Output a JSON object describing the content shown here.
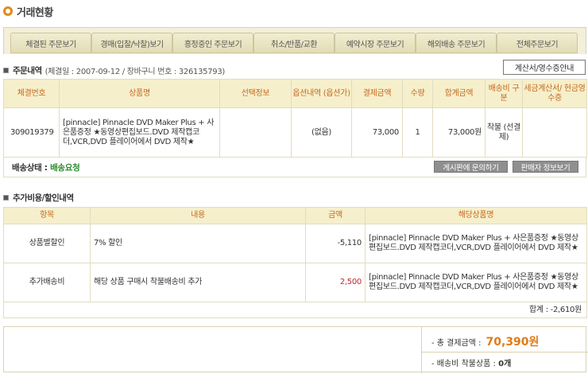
{
  "page": {
    "title": "거래현황"
  },
  "tabs": [
    "체결된 주문보기",
    "경매(입찰/낙찰)보기",
    "흥정중인 주문보기",
    "취소/반품/교환",
    "예약시장 주문보기",
    "해외배송 주문보기",
    "전체주문보기"
  ],
  "order": {
    "section_title": "주문내역",
    "section_sub": "(체결일 : 2007-09-12 / 장바구니 번호 : 326135793)",
    "receipt_button": "계산서/영수증안내",
    "headers": [
      "체결번호",
      "상품명",
      "선택정보",
      "옵션내역 (옵션가)",
      "결제금액",
      "수량",
      "합계금액",
      "배송비 구분",
      "세금계산서/ 현금영수증"
    ],
    "row": {
      "order_no": "309019379",
      "product": "[pinnacle] Pinnacle DVD Maker Plus + 사은품증정 ★동영상편집보드.DVD 제작캡코더,VCR,DVD 플레이어에서 DVD 제작★",
      "option_info": "",
      "option_detail": "(없음)",
      "price": "73,000",
      "qty": "1",
      "total": "73,000원",
      "shipping_type": "착불 (선결제)",
      "tax_receipt": ""
    },
    "status_label": "배송상태 :",
    "status_value": "배송요청",
    "inquiry_button": "게시판에 문의하기",
    "seller_button": "판매자 정보보기"
  },
  "extra": {
    "section_title": "추가비용/할인내역",
    "headers": [
      "항목",
      "내용",
      "금액",
      "해당상품명"
    ],
    "rows": [
      {
        "item": "상품별할인",
        "content": "7% 할인",
        "amount": "-5,110",
        "product": "[pinnacle] Pinnacle DVD Maker Plus + 사은품증정 ★동영상편집보드.DVD 제작캡코더,VCR,DVD 플레이어에서 DVD 제작★"
      },
      {
        "item": "추가배송비",
        "content": "해당 상품 구매시 착불배송비 추가",
        "amount": "2,500",
        "product": "[pinnacle] Pinnacle DVD Maker Plus + 사은품증정 ★동영상편집보드.DVD 제작캡코더,VCR,DVD 플레이어에서 DVD 제작★"
      }
    ],
    "total_note": "합계 : -2,610원"
  },
  "summary": {
    "total_label": "- 총 결제금액 :",
    "total_value": "70,390원",
    "cod_label": "- 배송비 착불상품 :",
    "cod_value": "0개"
  },
  "colors": {
    "accent": "#e07b18",
    "header_text": "#c46a1c",
    "header_bg": "#f6efcc",
    "status_green": "#2e8b2e",
    "negative_red": "#c0282d"
  }
}
